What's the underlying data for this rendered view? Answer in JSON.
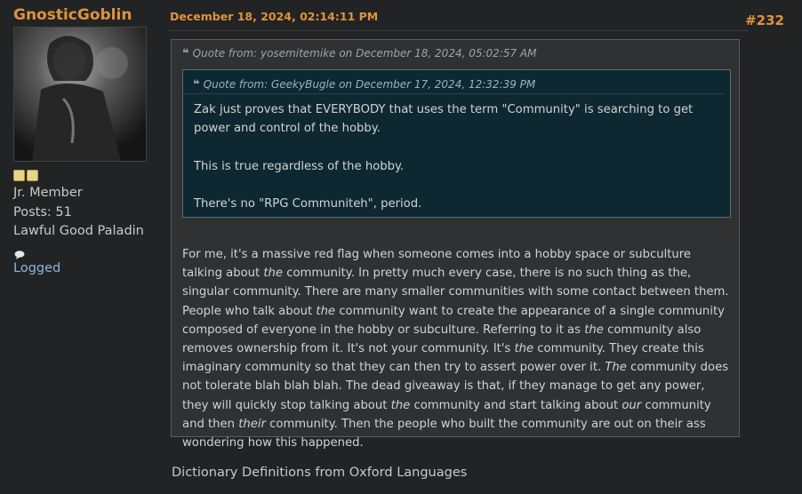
{
  "poster": {
    "username": "GnosticGoblin",
    "rank": "Jr. Member",
    "posts": "Posts: 51",
    "title": "Lawful Good Paladin",
    "logged": "Logged",
    "star_count": 2
  },
  "post": {
    "date": "December 18, 2024, 02:14:11 PM",
    "number": "#232"
  },
  "outer_quote": {
    "header": "Quote from: yosemitemike on December 18, 2024, 05:02:57 AM",
    "inner_quote": {
      "header": "Quote from: GeekyBugle on December 17, 2024, 12:32:39 PM",
      "paragraphs": [
        "Zak just proves that EVERYBODY that uses the term \"Community\" is searching to get power and control of the hobby.",
        "This is true regardless of the hobby.",
        "There's no \"RPG Communiteh\", period."
      ]
    },
    "body_segments": [
      {
        "t": "For me, it's a massive red flag when someone comes into a hobby space or subculture talking about ",
        "i": false
      },
      {
        "t": "the",
        "i": true
      },
      {
        "t": " community.  In pretty much every case, there is no such thing as the, singular community.  There are many smaller communities with some contact between them.  People who talk about ",
        "i": false
      },
      {
        "t": "the",
        "i": true
      },
      {
        "t": " community want to create the appearance of a single community composed of everyone in the hobby or subculture.  Referring to it as ",
        "i": false
      },
      {
        "t": "the",
        "i": true
      },
      {
        "t": " community also removes ownership from it.  It's not your community.  It's ",
        "i": false
      },
      {
        "t": "the",
        "i": true
      },
      {
        "t": " community.  They create this imaginary community so that they can then try to assert power over it.  ",
        "i": false
      },
      {
        "t": "The",
        "i": true
      },
      {
        "t": " community does not tolerate blah blah blah.  The dead giveaway is that, if they manage to get any power, they will quickly stop talking about ",
        "i": false
      },
      {
        "t": "the",
        "i": true
      },
      {
        "t": " community and start talking about ",
        "i": false
      },
      {
        "t": "our",
        "i": true
      },
      {
        "t": " community and then ",
        "i": false
      },
      {
        "t": "their",
        "i": true
      },
      {
        "t": " community.  Then the people who built the community are out on their ass wondering how this happened.",
        "i": false
      }
    ]
  },
  "footer_text": "Dictionary Definitions from Oxford Languages",
  "colors": {
    "accent": "#e0933a",
    "link": "#8fb4dc",
    "background": "#222325",
    "inner_quote_bg": "#0e2831"
  },
  "icons": {
    "quote": "quote-icon",
    "bubble": "speech-bubble-icon",
    "star": "star-icon"
  }
}
